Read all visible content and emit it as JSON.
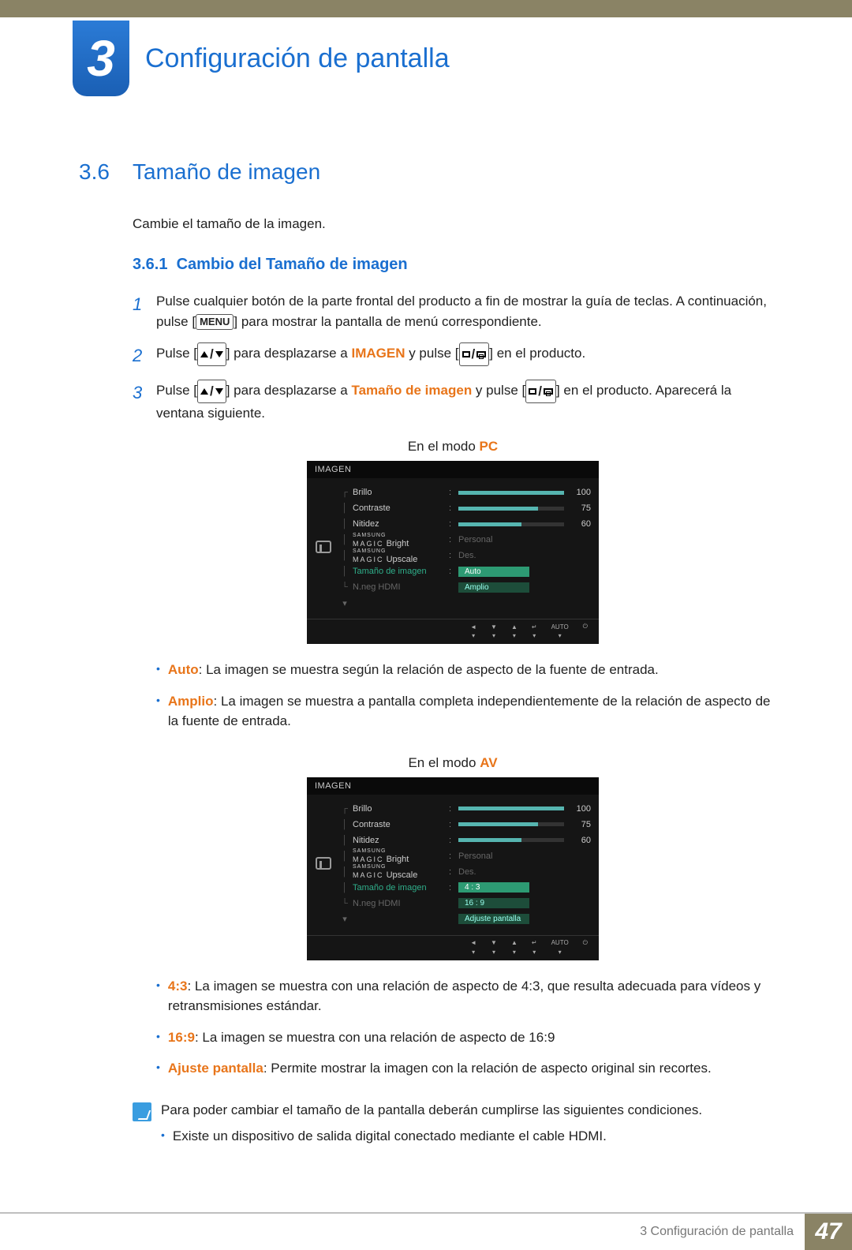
{
  "chapter": {
    "number": "3",
    "title": "Configuración de pantalla"
  },
  "section": {
    "num": "3.6",
    "title": "Tamaño de imagen",
    "intro": "Cambie el tamaño de la imagen."
  },
  "subsection": {
    "num": "3.6.1",
    "title": "Cambio del Tamaño de imagen"
  },
  "steps": {
    "s1a": "Pulse cualquier botón de la parte frontal del producto a fin de mostrar la guía de teclas. A continuación, pulse [",
    "s1_menu": "MENU",
    "s1b": "] para mostrar la pantalla de menú correspondiente.",
    "s2a": "Pulse [",
    "s2b": "] para desplazarse a ",
    "s2_target": "IMAGEN",
    "s2c": " y pulse [",
    "s2d": "] en el producto.",
    "s3a": "Pulse [",
    "s3b": "] para desplazarse a ",
    "s3_target": "Tamaño de imagen",
    "s3c": " y pulse [",
    "s3d": "] en el producto. Aparecerá la ventana siguiente."
  },
  "modes": {
    "pc_prefix": "En el modo ",
    "pc": "PC",
    "av_prefix": "En el modo ",
    "av": "AV"
  },
  "osd": {
    "title": "IMAGEN",
    "brillo": "Brillo",
    "brillo_v": "100",
    "contraste": "Contraste",
    "contraste_v": "75",
    "nitidez": "Nitidez",
    "nitidez_v": "60",
    "magic_s": "SAMSUNG",
    "magic_b": "MAGIC",
    "bright_suffix": " Bright",
    "bright_v": "Personal",
    "upscale_suffix": " Upscale",
    "upscale_v": "Des.",
    "tamano": "Tamaño de imagen",
    "nneg": "N.neg HDMI",
    "pc_opt1": "Auto",
    "pc_opt2": "Amplio",
    "av_opt1": "4 : 3",
    "av_opt2": "16 : 9",
    "av_opt3": "Adjuste pantalla",
    "nav_auto": "AUTO"
  },
  "bullets_pc": {
    "auto_t": "Auto",
    "auto_d": ": La imagen se muestra según la relación de aspecto de la fuente de entrada.",
    "amplio_t": "Amplio",
    "amplio_d": ": La imagen se muestra a pantalla completa independientemente de la relación de aspecto de la fuente de entrada."
  },
  "bullets_av": {
    "b43_t": "4:3",
    "b43_d": ": La imagen se muestra con una relación de aspecto de 4:3, que resulta adecuada para vídeos y retransmisiones estándar.",
    "b169_t": "16:9",
    "b169_d": ": La imagen se muestra con una relación de aspecto de 16:9",
    "ajuste_t": "Ajuste pantalla",
    "ajuste_d": ": Permite mostrar la imagen con la relación de aspecto original sin recortes."
  },
  "note": {
    "intro": "Para poder cambiar el tamaño de la pantalla deberán cumplirse las siguientes condiciones.",
    "b1": "Existe un dispositivo de salida digital conectado mediante el cable HDMI."
  },
  "footer": {
    "text": "3 Configuración de pantalla",
    "page": "47"
  }
}
